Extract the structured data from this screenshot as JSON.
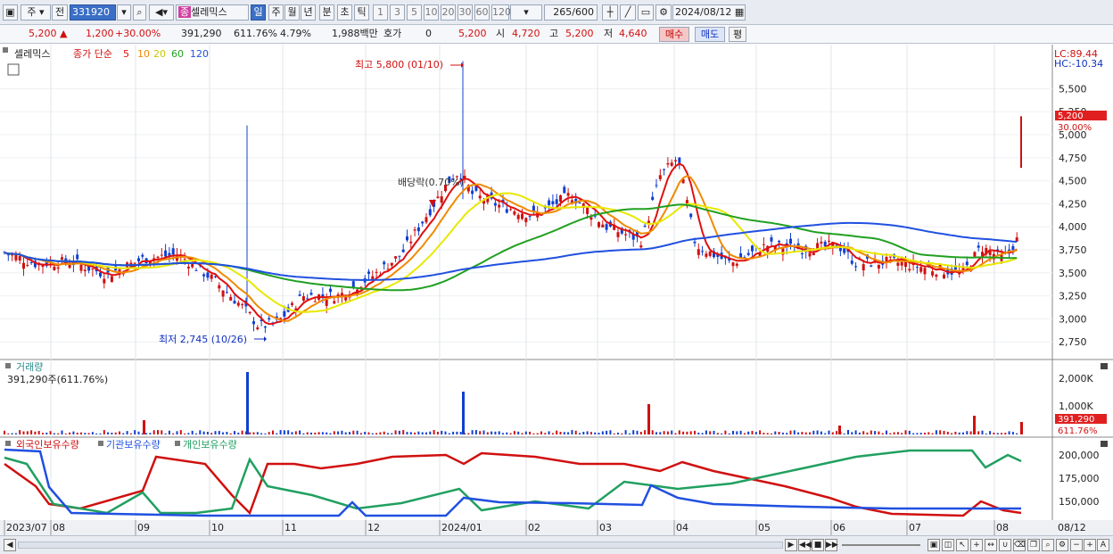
{
  "toolbar": {
    "period": "주",
    "prev_label": "전",
    "code": "331920",
    "stock_name": "셀레믹스",
    "intervals": [
      "일",
      "주",
      "월",
      "년",
      "분",
      "초",
      "틱"
    ],
    "numbers": [
      "1",
      "3",
      "5",
      "10",
      "20",
      "30",
      "60",
      "120"
    ],
    "count": "265",
    "count_total": "/600",
    "date": "2024/08/12",
    "badge": "종"
  },
  "quote": {
    "price": "5,200",
    "arrow": "▲",
    "change": "1,200",
    "change_pct": "+30.00%",
    "volume": "391,290",
    "volume_pct": "611.76%",
    "turnover": "4.79%",
    "amount": "1,988백만",
    "hoga_label": "호가",
    "hoga_value": "0",
    "ask": "5,200",
    "open_label": "시",
    "open": "4,720",
    "high_label": "고",
    "high": "5,200",
    "low_label": "저",
    "low": "4,640",
    "buy_label": "매수",
    "sell_label": "매도",
    "flat_label": "평"
  },
  "price_pane": {
    "name": "셀레믹스",
    "legend_prefix": "종가 단순",
    "ma": [
      {
        "label": "5",
        "color": "#e01010"
      },
      {
        "label": "10",
        "color": "#f08a00"
      },
      {
        "label": "20",
        "color": "#e8e800"
      },
      {
        "label": "60",
        "color": "#20a020"
      },
      {
        "label": "120",
        "color": "#2050e0"
      }
    ],
    "lc": "LC:89.44",
    "hc": "HC:-10.34",
    "y_ticks": [
      "5,500",
      "5,250",
      "5,000",
      "4,750",
      "4,500",
      "4,250",
      "4,000",
      "3,750",
      "3,500",
      "3,250",
      "3,000",
      "2,750"
    ],
    "high_note": "최고 5,800 (01/10)",
    "low_note": "최저 2,745 (10/26)",
    "dividend_note": "배당락(0.70%)",
    "price_tag": "5,200",
    "pct_tag": "30.00%"
  },
  "volume_pane": {
    "title": "거래량",
    "subtitle": "391,290주(611.76%)",
    "y_ticks": [
      "2,000K",
      "1,000K"
    ],
    "tag": "391,290",
    "tag_pct": "611.76%"
  },
  "holder_pane": {
    "legend": [
      {
        "label": "외국인보유수량",
        "color": "#d01010"
      },
      {
        "label": "기관보유수량",
        "color": "#2050e0"
      },
      {
        "label": "개인보유수량",
        "color": "#20a060"
      }
    ],
    "y_ticks": [
      "200,000",
      "175,000",
      "150,000"
    ]
  },
  "x_axis": [
    "2023/07",
    "08",
    "09",
    "10",
    "11",
    "12",
    "2024/01",
    "02",
    "03",
    "04",
    "05",
    "06",
    "07",
    "08"
  ],
  "x_end": "08/12"
}
